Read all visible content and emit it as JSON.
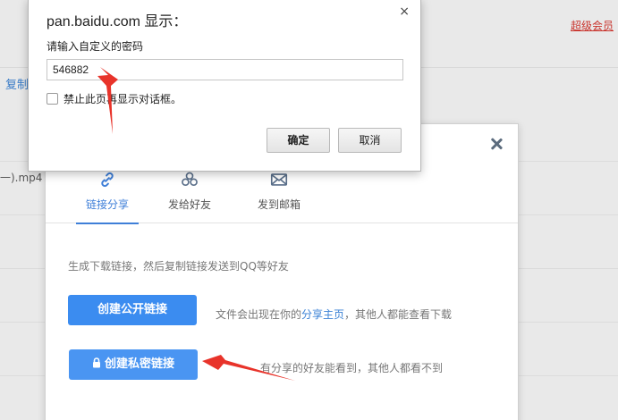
{
  "background": {
    "copy_text": "复制",
    "vip_text": "超级会员",
    "file_text": "一).mp4"
  },
  "share_dialog": {
    "tabs": [
      {
        "label": "链接分享",
        "icon": "link-icon"
      },
      {
        "label": "发给好友",
        "icon": "friends-icon"
      },
      {
        "label": "发到邮箱",
        "icon": "mail-icon"
      }
    ],
    "description": "生成下载链接，然后复制链接发送到QQ等好友",
    "public_button": "创建公开链接",
    "public_note_prefix": "文件会出现在你的",
    "public_note_link": "分享主页",
    "public_note_suffix": "，其他人都能查看下载",
    "private_button": "创建私密链接",
    "private_note": "有分享的好友能看到，其他人都看不到",
    "accent_color": "#3b8cf0"
  },
  "prompt": {
    "title": "pan.baidu.com 显示：",
    "message": "请输入自定义的密码",
    "input_value": "546882",
    "checkbox_label": "禁止此页再显示对话框。",
    "ok_label": "确定",
    "cancel_label": "取消",
    "close_glyph": "×"
  },
  "annotation_color": "#e8332a"
}
